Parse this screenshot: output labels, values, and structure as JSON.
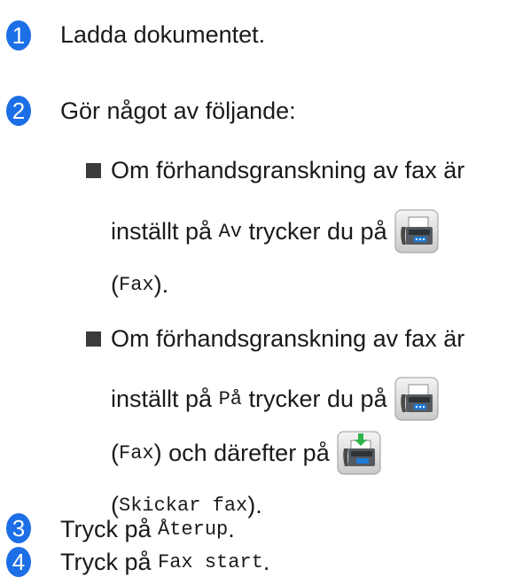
{
  "step1": {
    "number": "1",
    "text": "Ladda dokumentet."
  },
  "step2": {
    "number": "2",
    "text": "Gör något av följande:",
    "options": [
      {
        "line1": "Om förhandsgranskning av fax är",
        "line2_prefix": "inställt på",
        "line2_value": "Av",
        "line2_suffix": "trycker du på",
        "line3_paren_open": "(",
        "line3_value": "Fax",
        "line3_paren_close": ")."
      },
      {
        "line1": "Om förhandsgranskning av fax är",
        "line2_prefix": "inställt på",
        "line2_value": "På",
        "line2_suffix": "trycker du på",
        "line3_paren_open": "(",
        "line3_value": "Fax",
        "line3_mid": ") och därefter på",
        "line4_paren_open": "(",
        "line4_value": "Skickar fax",
        "line4_paren_close": ")."
      }
    ]
  },
  "step3": {
    "number": "3",
    "prefix": "Tryck på",
    "value": "Återup",
    "suffix": "."
  },
  "step4": {
    "number": "4",
    "prefix": "Tryck på",
    "value": "Fax start",
    "suffix": "."
  },
  "icons": {
    "fax_button": "fax-button-icon",
    "send_fax_button": "send-fax-button-icon"
  },
  "colors": {
    "step_badge": "#1c6fe6",
    "text": "#1a1a1a",
    "bullet": "#3b3b3b",
    "send_arrow": "#2db34a"
  }
}
